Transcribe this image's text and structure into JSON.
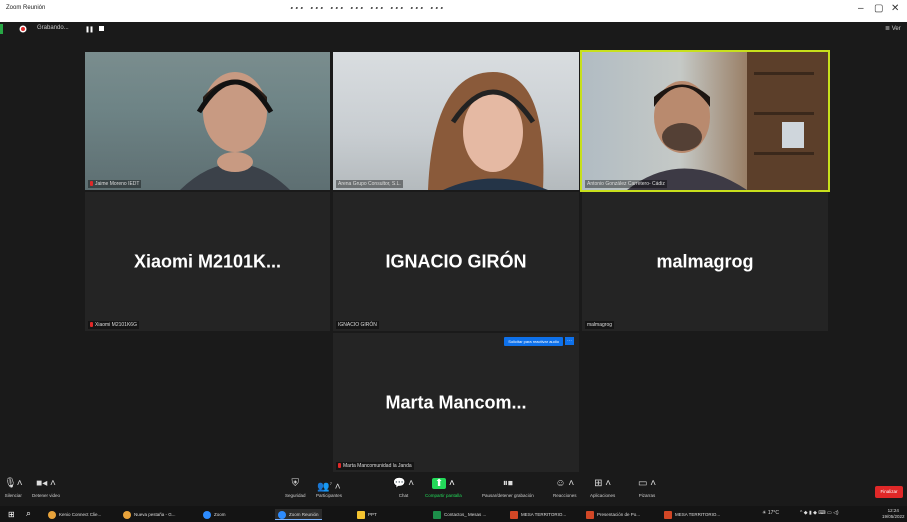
{
  "window": {
    "title": "Zoom Reunión",
    "overlay_caption": "... ... ... ... ... ... ... ...",
    "minimize": "–",
    "maximize": "▢",
    "close": "✕"
  },
  "recording": {
    "label": "Grabando...",
    "pause": "❚❚",
    "view_label": "≣ Ver"
  },
  "tiles": [
    {
      "name_tag": "Jaime Moreno IEDT",
      "mic_muted": true
    },
    {
      "name_tag": "Arena Grupo Consultor, S.L.",
      "mic_muted": false
    },
    {
      "name_tag": "Antonio González Carretero- Cádiz",
      "mic_muted": false
    },
    {
      "big_name": "Xiaomi  M2101K...",
      "name_tag": "Xiaomi M2101K6G",
      "mic_muted": true
    },
    {
      "big_name": "IGNACIO GIRÓN",
      "name_tag": "IGNACIO GIRÓN",
      "mic_muted": false
    },
    {
      "big_name": "malmagrog",
      "name_tag": "malmagrog",
      "mic_muted": false
    },
    {
      "big_name": "Marta  Mancom...",
      "name_tag": "Marta Mancomunidad la Janda",
      "mic_muted": true,
      "request_label": "Solicitar para reactivar audio"
    }
  ],
  "toolbar": {
    "mute": "Silenciar",
    "video": "Detener video",
    "security": "Seguridad",
    "participants": "Participantes",
    "participants_count": "7",
    "chat": "Chat",
    "share": "Compartir pantalla",
    "record": "Pausar/detener grabación",
    "reactions": "Reacciones",
    "apps": "Aplicaciones",
    "whiteboards": "Pizarras",
    "end": "Finalizar"
  },
  "taskbar": {
    "items": [
      "Kenio Connect Clie...",
      "Nueva pestaña - G...",
      "Zoom",
      "Zoom Reunión",
      "PPT",
      "Contactos_ Mesas ...",
      "MESA TERRITORIO...",
      "Presentación de Po...",
      "MESA TERRITORIO..."
    ],
    "weather": "17°C",
    "time": "12:24",
    "date": "19/05/2022"
  },
  "colors": {
    "active_speaker": "#c8e01c",
    "end_button": "#e02828",
    "share_green": "#23d959",
    "zoom_blue": "#0e71eb"
  }
}
